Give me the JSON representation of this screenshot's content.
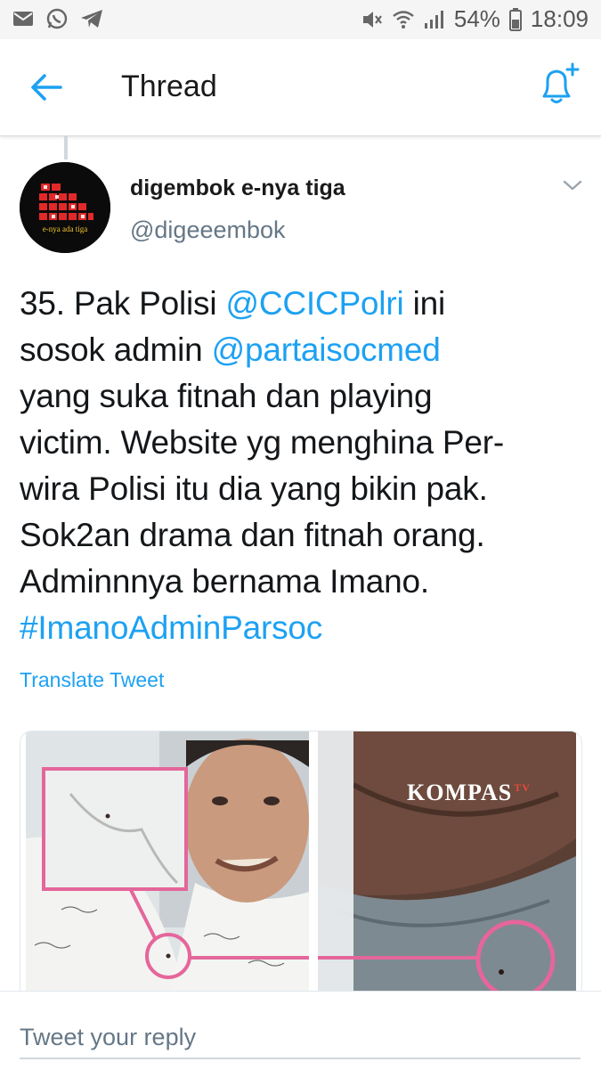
{
  "status_bar": {
    "battery": "54%",
    "time": "18:09",
    "icons": [
      "mail-icon",
      "whatsapp-icon",
      "telegram-icon",
      "mute-icon",
      "wifi-icon",
      "signal-icon",
      "battery-icon"
    ]
  },
  "header": {
    "title": "Thread",
    "back_icon": "arrow-left-icon",
    "notification_icon": "bell-plus-icon"
  },
  "tweet": {
    "author_name": "digembok e-nya tiga",
    "handle": "@digeeembok",
    "avatar_text": "e-nya ada tiga",
    "body": {
      "prefix": "35. Pak Polisi ",
      "mention1": "@CCICPolri",
      "mid1": " ini",
      "line2_prefix": "sosok admin ",
      "mention2": "@partaisocmed",
      "line3": "yang suka fitnah dan playing",
      "line4": "victim. Website yg menghina Per-",
      "line5": "wira Polisi itu dia yang bikin pak.",
      "line6": "Sok2an drama dan fitnah orang.",
      "line7": "Adminnnya bernama Imano.",
      "hashtag": "#ImanoAdminParsoc"
    },
    "translate_label": "Translate Tweet",
    "media": {
      "right_watermark": "KOMPAS",
      "right_watermark_sup": "TV"
    }
  },
  "reply": {
    "placeholder": "Tweet your reply"
  },
  "colors": {
    "accent": "#1da1f2",
    "text": "#14171a",
    "secondary": "#657786",
    "highlight": "#e4669b"
  }
}
